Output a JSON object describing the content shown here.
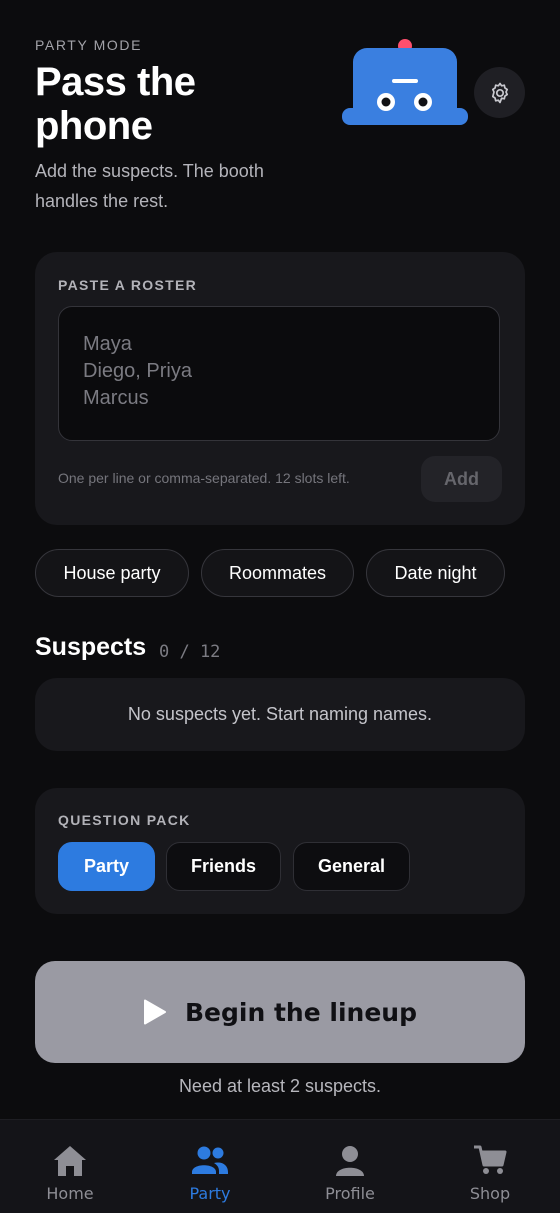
{
  "header": {
    "eyebrow": "PARTY MODE",
    "title_line1": "Pass the",
    "title_line2": "phone",
    "subtitle_line1": "Add the suspects. The booth",
    "subtitle_line2": "handles the rest."
  },
  "icons": {
    "settings": "gear-icon",
    "mascot": "robot-mascot",
    "play": "play-icon"
  },
  "roster": {
    "label": "PASTE A ROSTER",
    "placeholder": "Maya\nDiego, Priya\nMarcus",
    "hint": "One per line or comma-separated. 12 slots left.",
    "add_label": "Add"
  },
  "presets": [
    "House party",
    "Roommates",
    "Date night"
  ],
  "suspects": {
    "title": "Suspects",
    "count": "0 / 12",
    "empty_text": "No suspects yet. Start naming names."
  },
  "question_pack": {
    "label": "QUESTION PACK",
    "options": [
      "Party",
      "Friends",
      "General"
    ],
    "selected": "Party"
  },
  "cta": {
    "label": "Begin the lineup",
    "note": "Need at least 2 suspects."
  },
  "tabs": [
    {
      "label": "Home",
      "icon": "home-icon",
      "active": false
    },
    {
      "label": "Party",
      "icon": "users-icon",
      "active": true
    },
    {
      "label": "Profile",
      "icon": "user-icon",
      "active": false
    },
    {
      "label": "Shop",
      "icon": "cart-icon",
      "active": false
    }
  ],
  "colors": {
    "background": "#0c0c0e",
    "card": "#18181c",
    "accent": "#2d7be0",
    "mascot_body": "#3a7fe0",
    "mascot_antenna": "#ff4f6d",
    "cta_disabled": "#9a9aa3",
    "tab_inactive": "#8e8e95"
  }
}
